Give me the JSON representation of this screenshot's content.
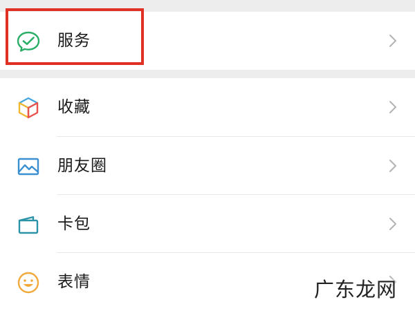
{
  "menu": {
    "services": {
      "label": "服务",
      "icon": "wechat-pay-icon",
      "color": "#2aae67"
    },
    "items": [
      {
        "label": "收藏",
        "icon": "favorites-cube-icon"
      },
      {
        "label": "朋友圈",
        "icon": "moments-photo-icon",
        "color": "#3a8fd1"
      },
      {
        "label": "卡包",
        "icon": "card-wallet-icon",
        "color": "#2a93a8"
      },
      {
        "label": "表情",
        "icon": "sticker-smiley-icon",
        "color": "#f2a93b"
      }
    ]
  },
  "highlight": {
    "color": "#e02f23"
  },
  "watermark": {
    "text": "广东龙网"
  }
}
